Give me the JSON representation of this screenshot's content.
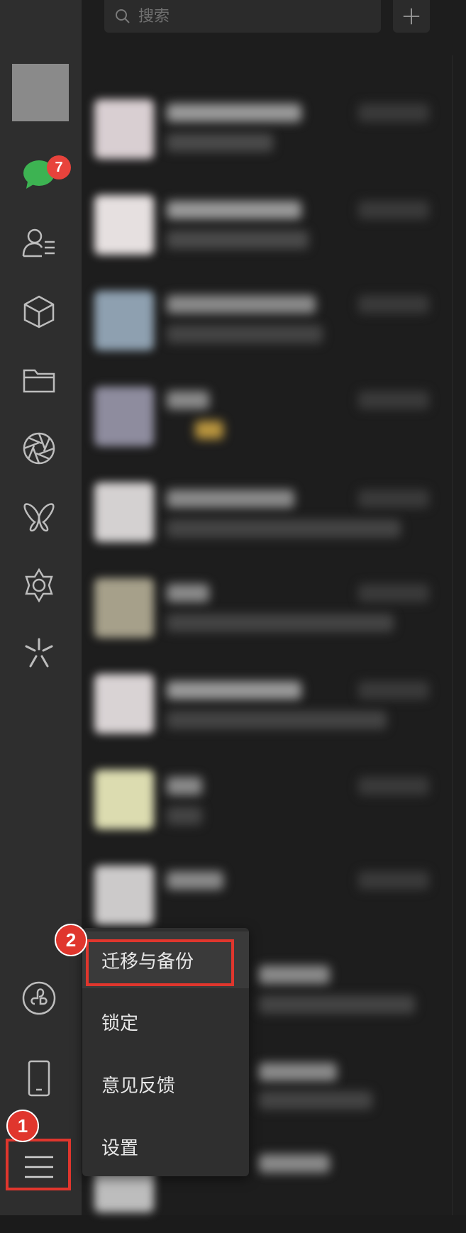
{
  "search": {
    "placeholder": "搜索"
  },
  "sidebar": {
    "unread_count": "7",
    "items": [
      {
        "name": "chats",
        "icon": "chat-bubble-icon"
      },
      {
        "name": "contacts",
        "icon": "contacts-icon"
      },
      {
        "name": "favorites",
        "icon": "cube-icon"
      },
      {
        "name": "files",
        "icon": "folder-icon"
      },
      {
        "name": "moments",
        "icon": "aperture-icon"
      },
      {
        "name": "channels",
        "icon": "butterfly-icon"
      },
      {
        "name": "search",
        "icon": "flower-icon"
      },
      {
        "name": "discover",
        "icon": "sparkle-icon"
      },
      {
        "name": "mini-programs",
        "icon": "mini-program-icon"
      },
      {
        "name": "phone",
        "icon": "phone-icon"
      },
      {
        "name": "more",
        "icon": "menu-icon"
      }
    ]
  },
  "menu": {
    "items": [
      {
        "label": "迁移与备份"
      },
      {
        "label": "锁定"
      },
      {
        "label": "意见反馈"
      },
      {
        "label": "设置"
      }
    ]
  },
  "annotations": {
    "step1": "1",
    "step2": "2",
    "highlight_color": "#e0362d"
  }
}
